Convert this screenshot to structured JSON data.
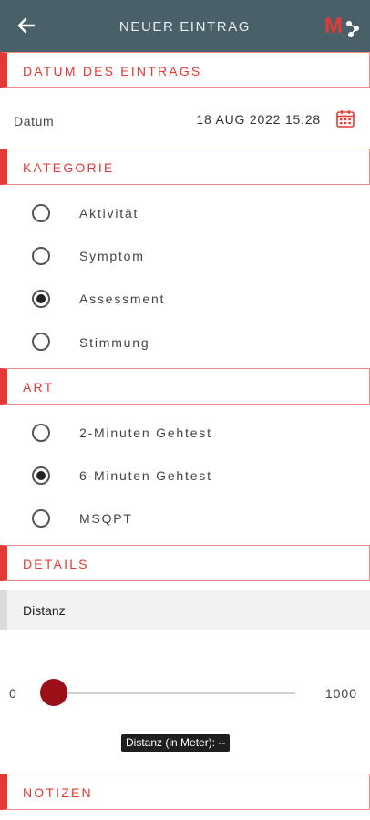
{
  "header": {
    "title": "NEUER EINTRAG",
    "back_icon": "arrow-left-icon",
    "logo": "M"
  },
  "sections": {
    "datum": "DATUM DES EINTRAGS",
    "kategorie": "KATEGORIE",
    "art": "ART",
    "details": "DETAILS",
    "notizen": "NOTIZEN"
  },
  "datum": {
    "label": "Datum",
    "value": "18 AUG 2022 15:28",
    "icon": "calendar-icon"
  },
  "kategorie_options": [
    {
      "label": "Aktivität",
      "checked": false
    },
    {
      "label": "Symptom",
      "checked": false
    },
    {
      "label": "Assessment",
      "checked": true
    },
    {
      "label": "Stimmung",
      "checked": false
    }
  ],
  "art_options": [
    {
      "label": "2-Minuten Gehtest",
      "checked": false
    },
    {
      "label": "6-Minuten Gehtest",
      "checked": true
    },
    {
      "label": "MSQPT",
      "checked": false
    }
  ],
  "details": {
    "field_label": "Distanz",
    "slider_min": "0",
    "slider_max": "1000",
    "slider_value": 0,
    "tooltip": "Distanz (in Meter): --"
  },
  "colors": {
    "accent": "#e53935",
    "header_bg": "#4a6068",
    "slider_thumb": "#9b1017"
  }
}
